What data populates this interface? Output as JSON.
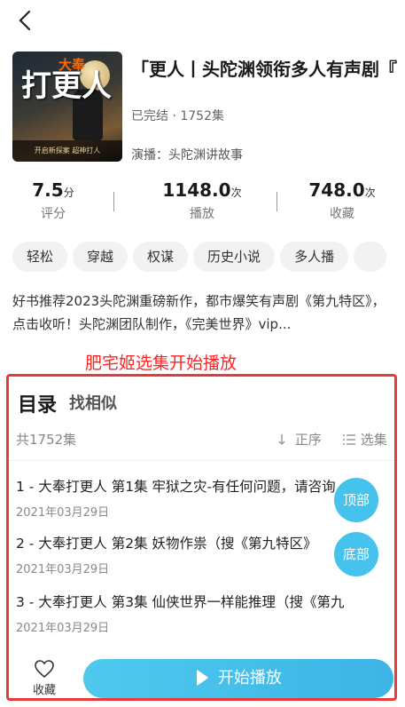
{
  "header": {
    "back_icon": "chevron-left-icon"
  },
  "book": {
    "cover_tag": "大奉",
    "cover_big": "打更人",
    "cover_bottom": "开启新探案 超神打人",
    "title": "「更人丨头陀渊领衔多人有声剧『",
    "status": "已完结 · 1752集",
    "narrator": "演播：头陀渊讲故事"
  },
  "stats": [
    {
      "value": "7.5",
      "unit": "分",
      "label": "评分"
    },
    {
      "value": "1148.0",
      "unit": "次",
      "label": "播放"
    },
    {
      "value": "748.0",
      "unit": "次",
      "label": "收藏"
    }
  ],
  "tags": [
    "轻松",
    "穿越",
    "权谋",
    "历史小说",
    "多人播"
  ],
  "description": "好书推荐2023头陀渊重磅新作，都市爆笑有声剧《第九特区》，点击收听！头陀渊团队制作，《完美世界》vip...",
  "promo": "肥宅姬选集开始播放",
  "toc": {
    "title": "目录",
    "find_similar": "找相似",
    "count": "共1752集",
    "order": "正序",
    "select": "选集",
    "episodes": [
      {
        "title": "1 - 大奉打更人 第1集 牢狱之灾-有任何问题，请咨询",
        "date": "2021年03月29日"
      },
      {
        "title": "2 - 大奉打更人 第2集 妖物作祟（搜《第九特区》",
        "date": "2021年03月29日"
      },
      {
        "title": "3 - 大奉打更人 第3集 仙侠世界一样能推理（搜《第九",
        "date": "2021年03月29日"
      }
    ],
    "top_button": "顶部",
    "bottom_button": "底部",
    "favorite_label": "收藏",
    "play_label": "开始播放"
  },
  "colors": {
    "accent": "#45c3ec",
    "highlight_border": "#e8393b",
    "promo": "#ff2424"
  }
}
